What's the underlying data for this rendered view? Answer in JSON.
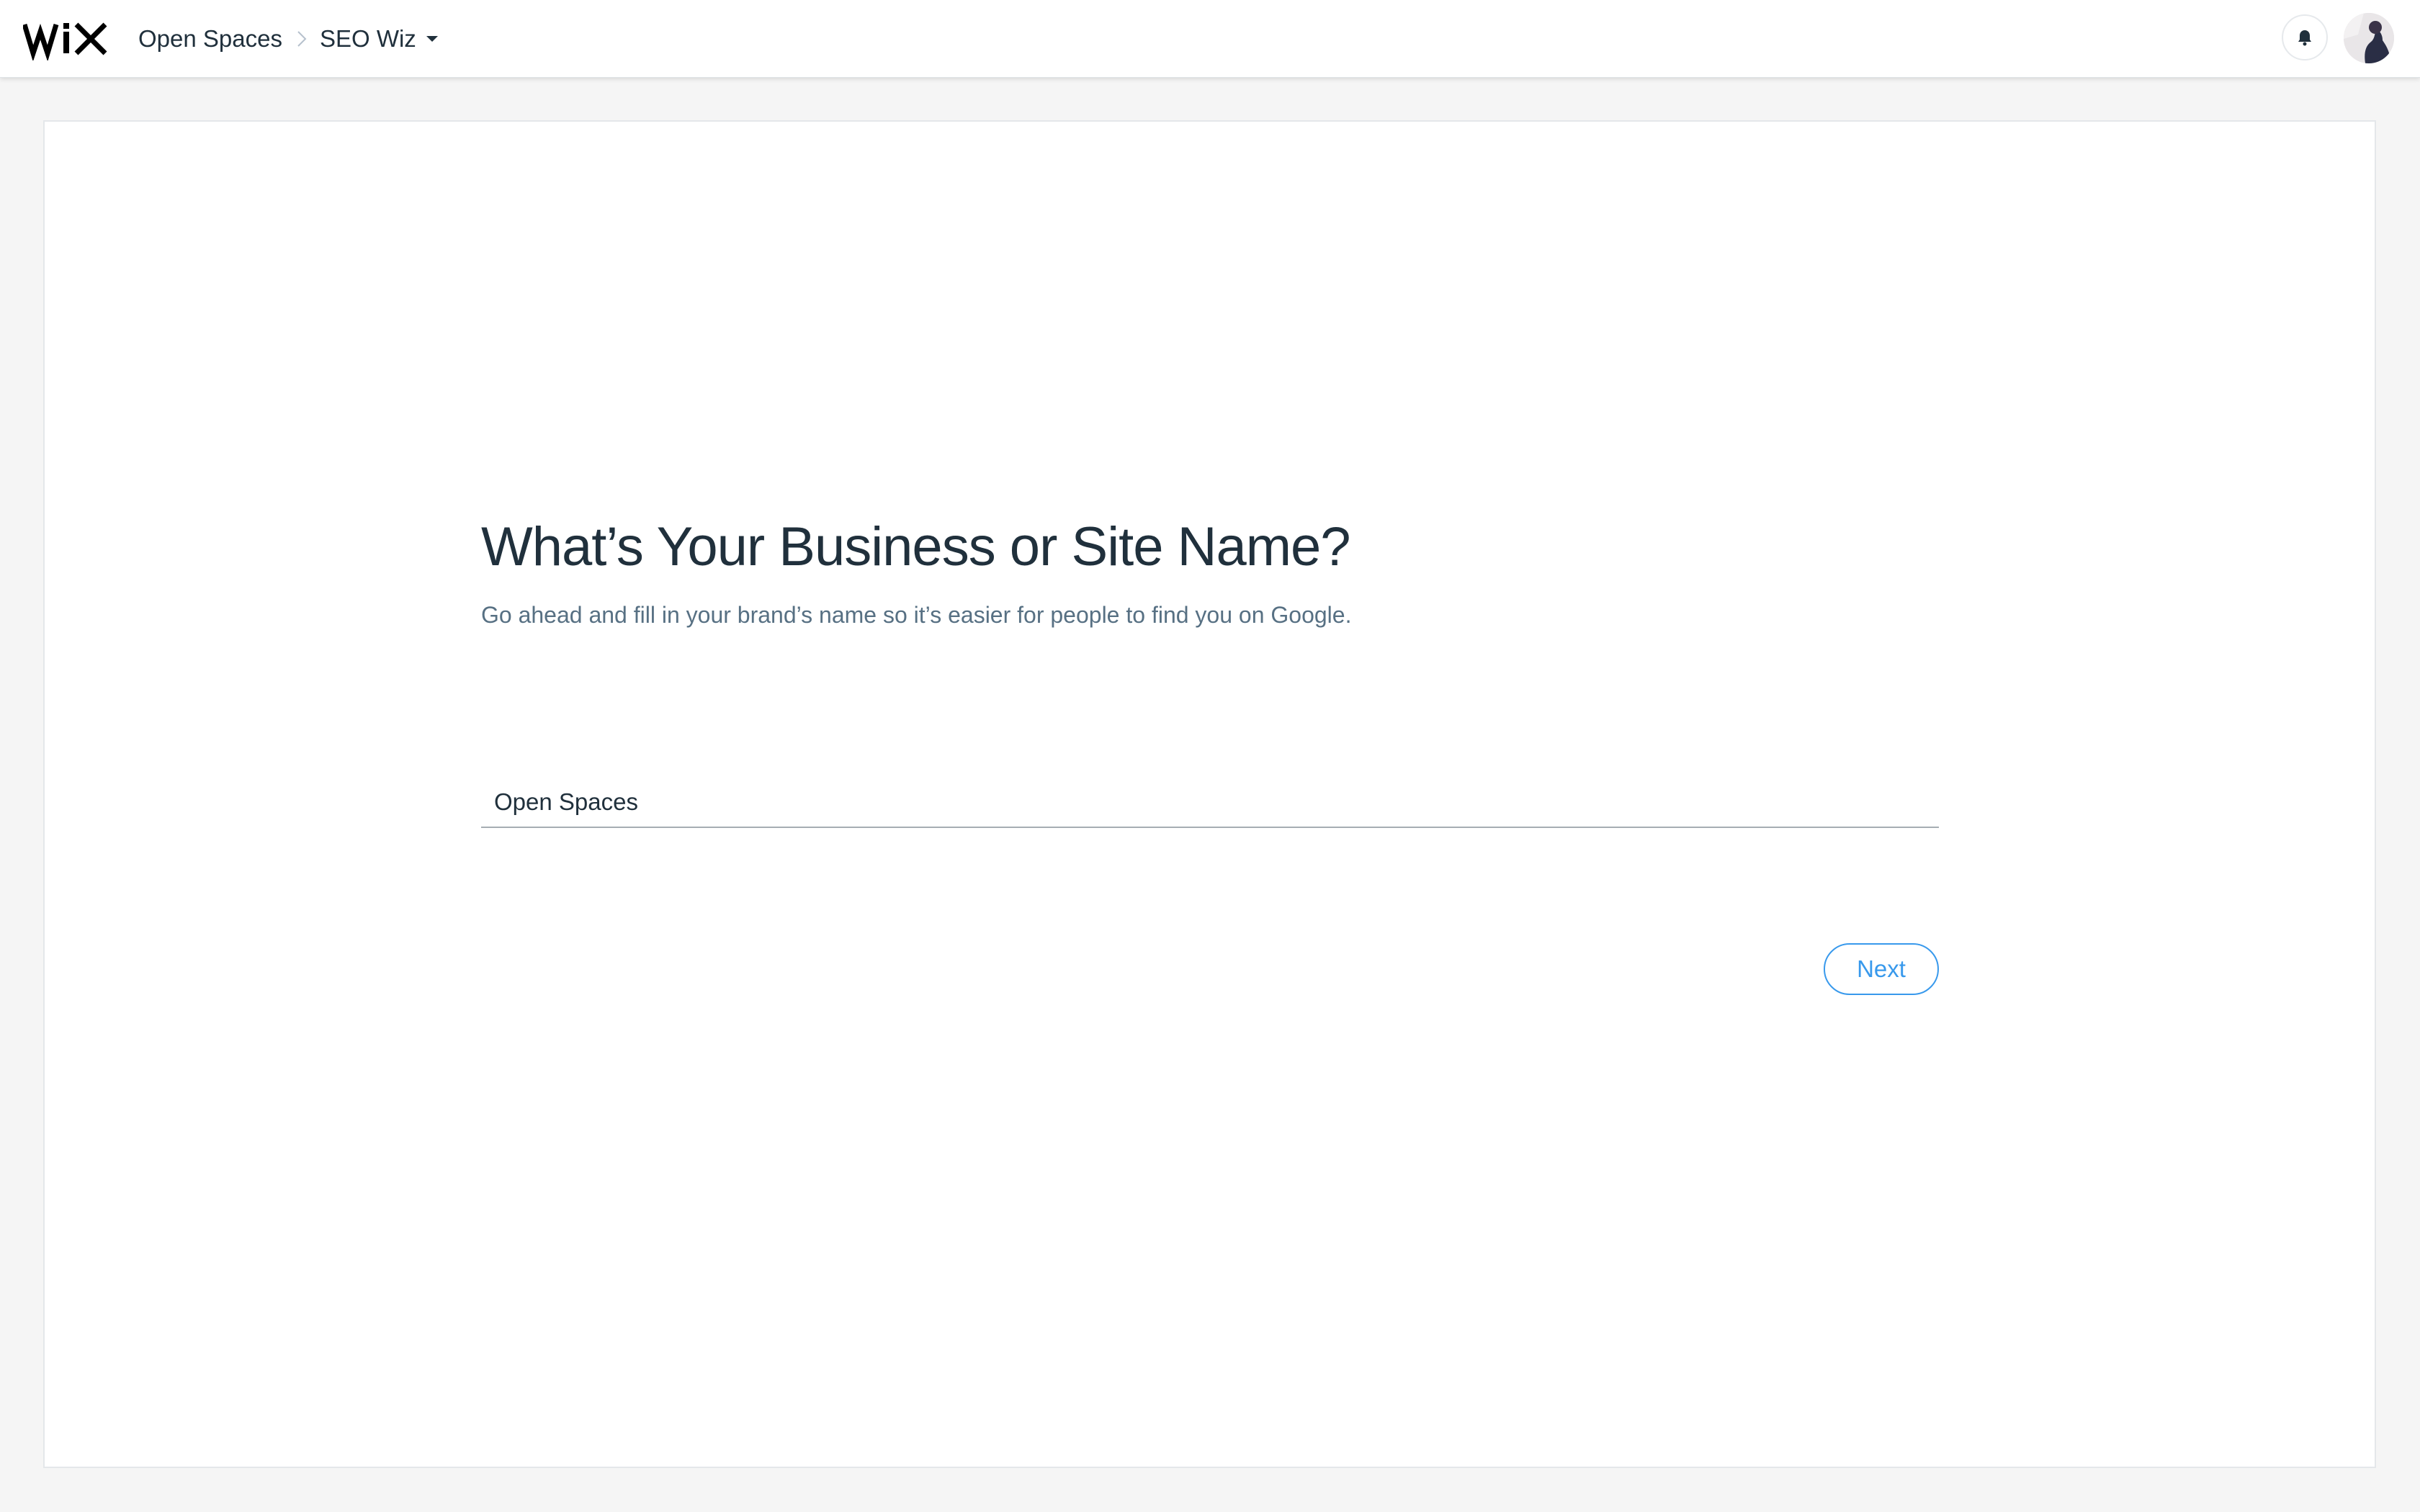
{
  "app": {
    "logo_text": "WIX"
  },
  "header": {
    "breadcrumb": {
      "site": "Open Spaces",
      "current": "SEO Wiz"
    },
    "icons": {
      "notifications": "bell-icon",
      "separator": "chevron-right-icon",
      "dropdown": "caret-down-icon"
    }
  },
  "main": {
    "title": "What’s Your Business or Site Name?",
    "subtitle": "Go ahead and fill in your brand’s name so it’s easier for people to find you on Google.",
    "name_field": {
      "value": "Open Spaces"
    },
    "next_label": "Next"
  },
  "colors": {
    "accent": "#3899ec",
    "text_primary": "#20303c",
    "text_secondary": "#577083"
  }
}
